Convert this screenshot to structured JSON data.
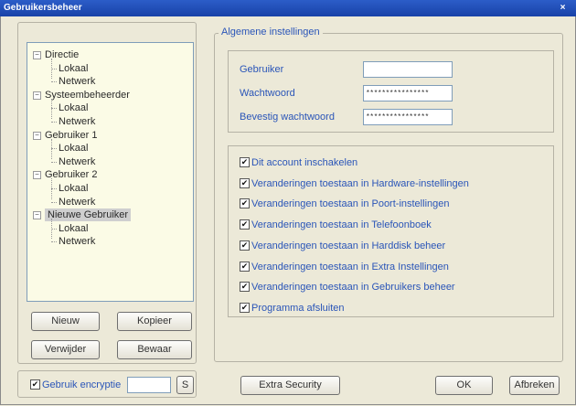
{
  "window": {
    "title": "Gebruikersbeheer",
    "close_glyph": "×"
  },
  "tree": {
    "items": [
      {
        "label": "Directie",
        "children": [
          "Lokaal",
          "Netwerk"
        ]
      },
      {
        "label": "Systeembeheerder",
        "children": [
          "Lokaal",
          "Netwerk"
        ]
      },
      {
        "label": "Gebruiker 1",
        "children": [
          "Lokaal",
          "Netwerk"
        ]
      },
      {
        "label": "Gebruiker 2",
        "children": [
          "Lokaal",
          "Netwerk"
        ]
      },
      {
        "label": "Nieuwe Gebruiker",
        "children": [
          "Lokaal",
          "Netwerk"
        ],
        "selected": true
      }
    ]
  },
  "buttons": {
    "new": "Nieuw",
    "copy": "Kopieer",
    "delete": "Verwijder",
    "save": "Bewaar",
    "extra_security": "Extra Security",
    "ok": "OK",
    "cancel": "Afbreken"
  },
  "encryption": {
    "label": "Gebruik encryptie",
    "checked": true,
    "value": "",
    "button": "S"
  },
  "settings": {
    "legend": "Algemene instellingen",
    "user_label": "Gebruiker",
    "user_value": "",
    "password_label": "Wachtwoord",
    "password_value": "****************",
    "confirm_label": "Bevestig wachtwoord",
    "confirm_value": "****************"
  },
  "permissions": [
    {
      "label": "Dit account inschakelen",
      "checked": true
    },
    {
      "label": "Veranderingen toestaan in Hardware-instellingen",
      "checked": true
    },
    {
      "label": "Veranderingen toestaan in Poort-instellingen",
      "checked": true
    },
    {
      "label": "Veranderingen toestaan in Telefoonboek",
      "checked": true
    },
    {
      "label": "Veranderingen toestaan in Harddisk beheer",
      "checked": true
    },
    {
      "label": "Veranderingen toestaan in Extra Instellingen",
      "checked": true
    },
    {
      "label": "Veranderingen toestaan in Gebruikers beheer",
      "checked": true
    },
    {
      "label": "Programma afsluiten",
      "checked": true
    }
  ],
  "check_glyph": "✔",
  "icons": {
    "expand": "minus-box-icon",
    "checkbox": "checkmark-icon"
  }
}
